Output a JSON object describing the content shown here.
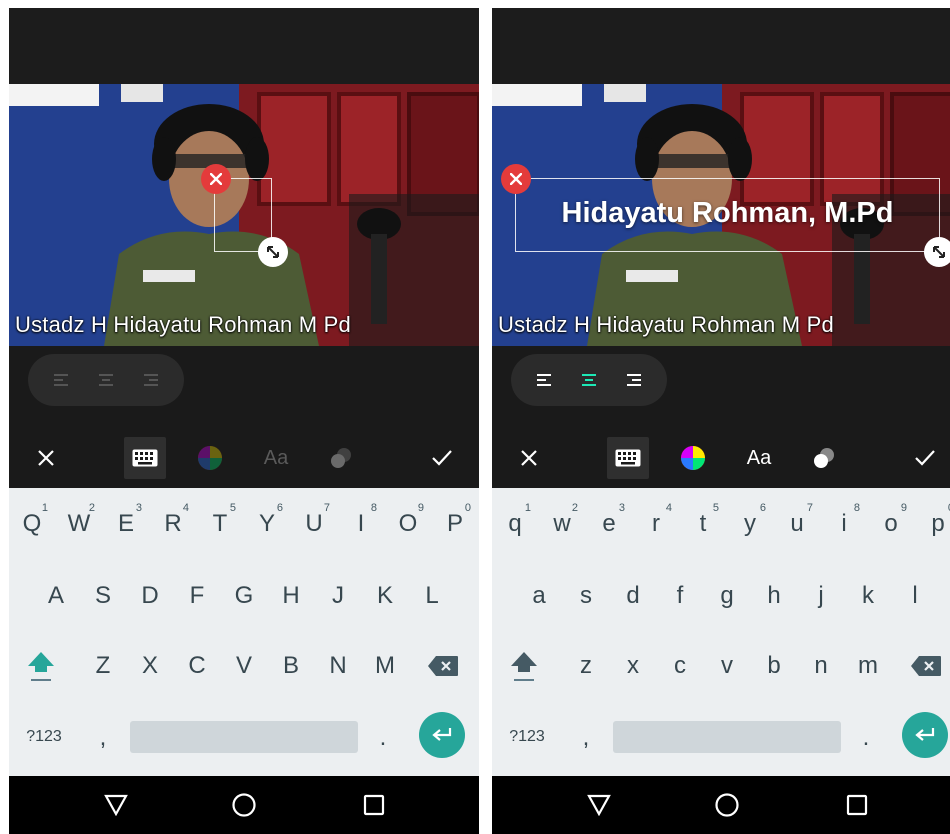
{
  "subtitle": "Ustadz H Hidayatu Rohman M Pd",
  "overlay_text": "Hidayatu Rohman, M.Pd",
  "toolbar": {
    "font_label": "Aa"
  },
  "keyboard": {
    "row1_upper": [
      "Q",
      "W",
      "E",
      "R",
      "T",
      "Y",
      "U",
      "I",
      "O",
      "P"
    ],
    "row1_lower": [
      "q",
      "w",
      "e",
      "r",
      "t",
      "y",
      "u",
      "i",
      "o",
      "p"
    ],
    "row1_hints": [
      "1",
      "2",
      "3",
      "4",
      "5",
      "6",
      "7",
      "8",
      "9",
      "0"
    ],
    "row2_upper": [
      "A",
      "S",
      "D",
      "F",
      "G",
      "H",
      "J",
      "K",
      "L"
    ],
    "row2_lower": [
      "a",
      "s",
      "d",
      "f",
      "g",
      "h",
      "j",
      "k",
      "l"
    ],
    "row3_upper": [
      "Z",
      "X",
      "C",
      "V",
      "B",
      "N",
      "M"
    ],
    "row3_lower": [
      "z",
      "x",
      "c",
      "v",
      "b",
      "n",
      "m"
    ],
    "symbols_label": "?123",
    "comma": ",",
    "period": "."
  },
  "colors": {
    "accent": "#26a69a",
    "delete": "#e43b3b",
    "align_active": "#1de9b6"
  },
  "icons": [
    "close-icon",
    "keyboard-icon",
    "color-wheel-icon",
    "font-icon",
    "opacity-icon",
    "check-icon",
    "delete-text-icon",
    "resize-icon",
    "align-left-icon",
    "align-center-icon",
    "align-right-icon",
    "shift-icon",
    "backspace-icon",
    "enter-icon",
    "back-icon",
    "home-icon",
    "recents-icon"
  ]
}
